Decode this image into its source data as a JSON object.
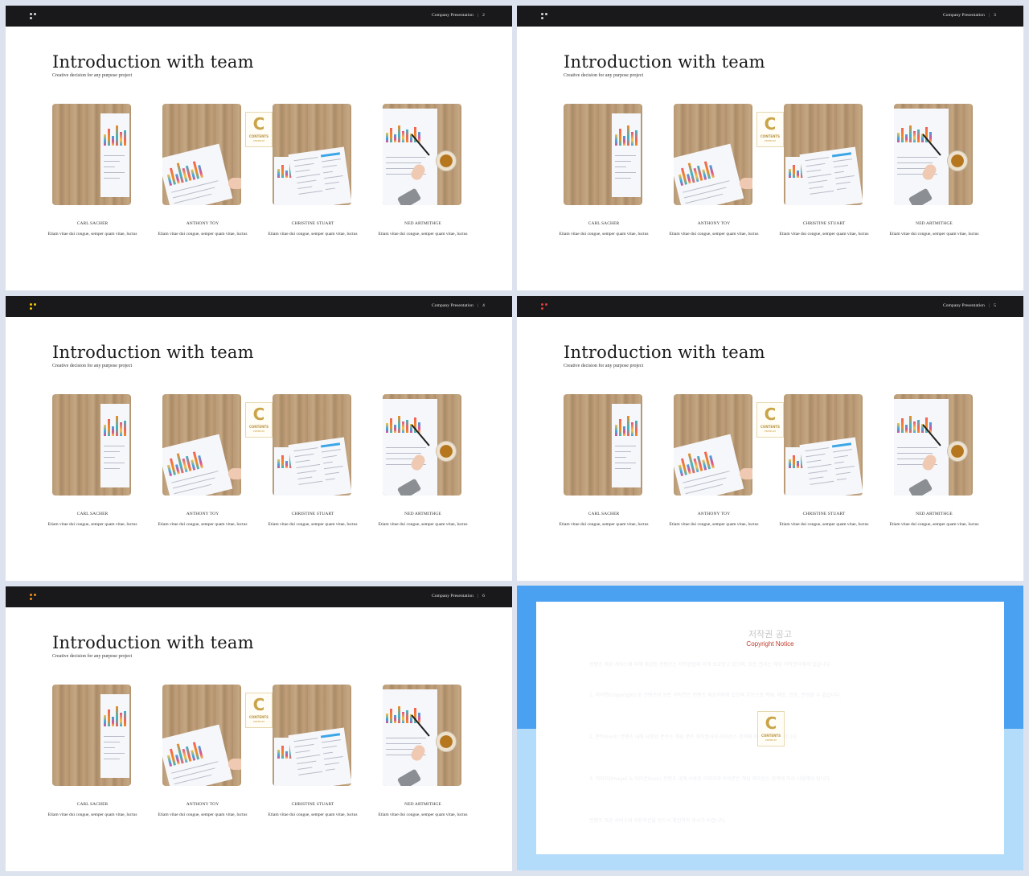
{
  "header": {
    "company": "Company Presentation",
    "separator": "|"
  },
  "slide_content": {
    "title": "Introduction with team",
    "subtitle": "Creative decision for any purpose  project"
  },
  "team": [
    {
      "name": "CARL SACHER",
      "desc": "Etiam vitae dui congue, semper quam vitae, luctus",
      "photo": "wood-desk-with-chart-paper"
    },
    {
      "name": "ANTHONY TOY",
      "desc": "Etiam vitae dui congue, semper quam vitae, luctus",
      "photo": "wood-desk-with-bar-chart-and-hand"
    },
    {
      "name": "CHRISTINE STUART",
      "desc": "Etiam vitae dui congue, semper quam vitae, luctus",
      "photo": "wood-desk-with-report-papers"
    },
    {
      "name": "NED ARTMITHGE",
      "desc": "Etiam vitae dui congue, semper quam vitae, luctus",
      "photo": "hand-drawing-chart-with-coffee"
    }
  ],
  "slides": [
    {
      "page": "2",
      "dot_colors": [
        "#d8d8d8",
        "#d8d8d8",
        "#d8d8d8"
      ]
    },
    {
      "page": "3",
      "dot_colors": [
        "#d8d8d8",
        "#d8d8d8",
        "#d8d8d8"
      ]
    },
    {
      "page": "4",
      "dot_colors": [
        "#f2c400",
        "#f2c400",
        "#f2c400"
      ]
    },
    {
      "page": "5",
      "dot_colors": [
        "#e23b3b",
        "#e23b3b",
        "#e23b3b"
      ]
    },
    {
      "page": "6",
      "dot_colors": [
        "#f08c1e",
        "#f08c1e",
        "#f08c1e"
      ]
    }
  ],
  "watermark": {
    "letter": "C",
    "text": "CONTENTS",
    "sub": "PREMIUM"
  },
  "copyright": {
    "title_kr": "저작권 공고",
    "title_en": "Copyright Notice",
    "paragraphs": [
      "컨텐츠 제공 서비스에 의해 제공된 컨텐츠는 저작권법에 의해 보호받고 있으며, 모든 권리는 해당 저작권자에게 있습니다.",
      "1. 저작권(Copyright) 본 컨텐츠의 모든 저작권은 컨텐츠 제공자에게 있으며 무단으로 복제, 배포, 전송, 변경할 수 없습니다.",
      "2. 폰트(Font) 컨텐츠 내에 사용된 폰트는 해당 폰트 저작권자의 라이선스 정책에 따라 사용해야 합니다.",
      "3. 이미지(Image) & 아이콘(Icon) 컨텐츠 내에 사용된 이미지와 아이콘은 해당 라이선스 정책에 따라 사용해야 합니다.",
      "컨텐츠 제공 서비스의 이용약관을 반드시 확인하여 주시기 바랍니다."
    ]
  },
  "colors": {
    "topbar": "#19191b",
    "copyright_band_top": "#4aa1f1",
    "copyright_band_bottom": "#b3dbfa",
    "page_bg": "#dde3ee"
  }
}
